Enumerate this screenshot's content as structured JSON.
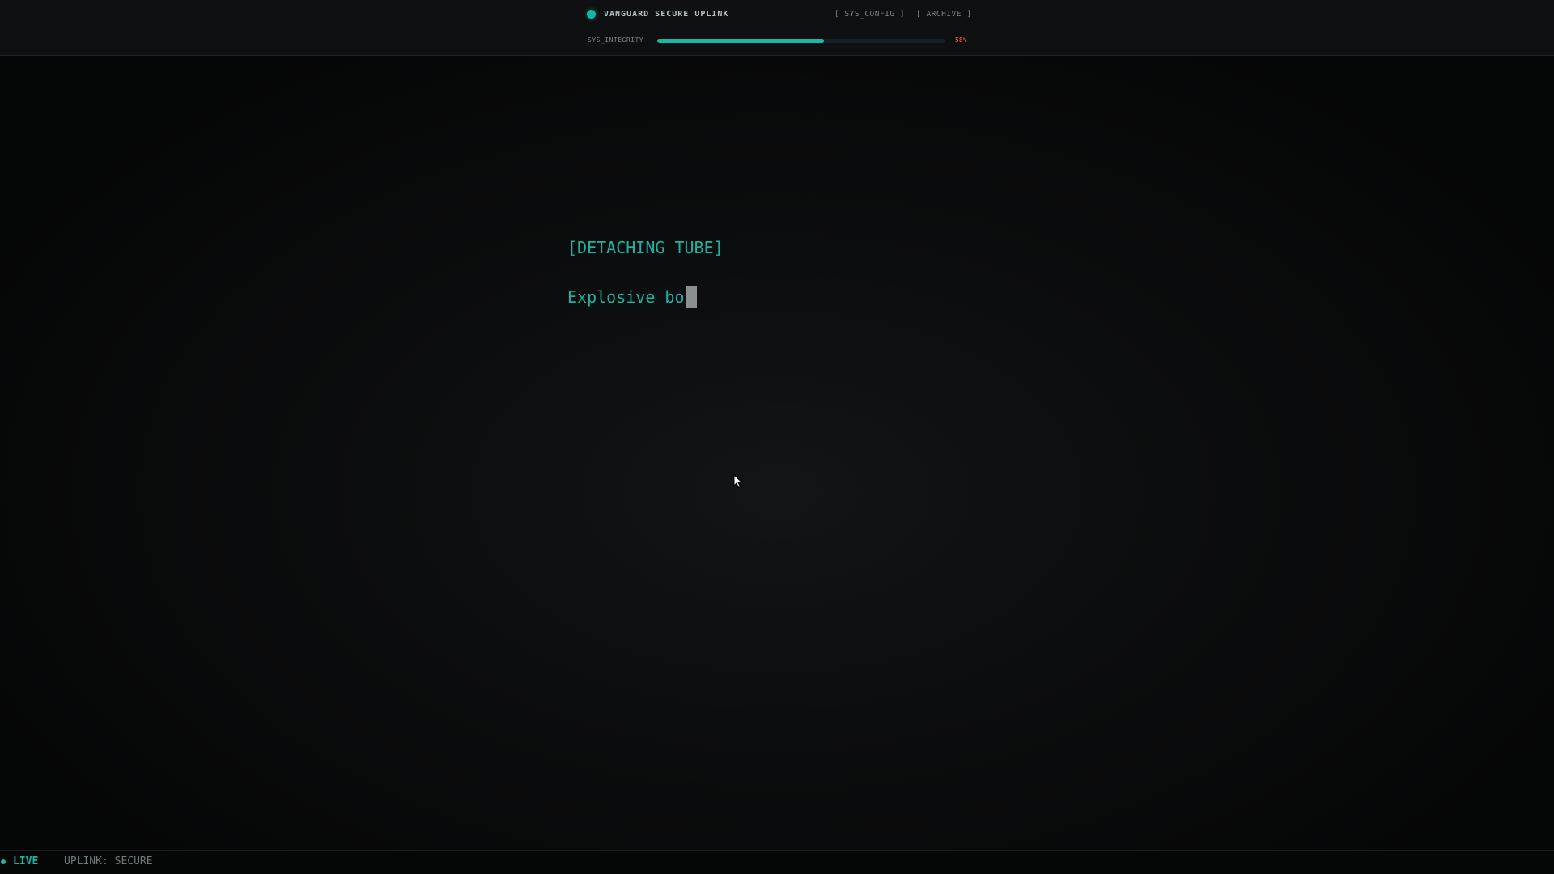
{
  "header": {
    "title": "VANGUARD SECURE UPLINK",
    "nav": {
      "sys_config": "[ SYS_CONFIG ]",
      "archive": "[ ARCHIVE ]"
    },
    "integrity": {
      "label": "SYS_INTEGRITY",
      "value_text": "58%",
      "percent": 58
    }
  },
  "terminal": {
    "heading": "[DETACHING TUBE]",
    "line": "Explosive bo"
  },
  "footer": {
    "live_label": "LIVE",
    "uplink_status": "UPLINK: SECURE"
  },
  "colors": {
    "accent": "#1eb3a1",
    "warning": "#e0503c",
    "background": "#050607"
  }
}
